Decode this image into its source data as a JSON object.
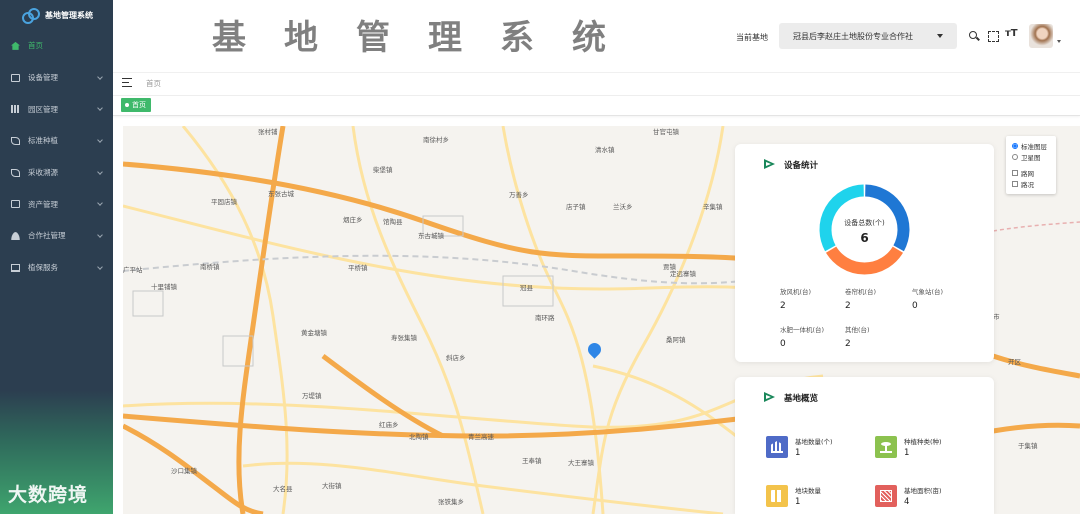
{
  "sidebar": {
    "brand": "基地管理系统",
    "watermark": "大数跨境",
    "items": [
      {
        "label": "首页",
        "active": true
      },
      {
        "label": "设备管理"
      },
      {
        "label": "园区管理"
      },
      {
        "label": "标准种植"
      },
      {
        "label": "采收溯源"
      },
      {
        "label": "资产管理"
      },
      {
        "label": "合作社管理"
      },
      {
        "label": "植保服务"
      }
    ]
  },
  "header": {
    "title": "基地管理系统",
    "base_label": "当前基地",
    "base_value": "冠县后李赵庄土地股份专业合作社",
    "font_size_icon_text": "тT"
  },
  "breadcrumb": "首页",
  "tag": "首页",
  "map": {
    "layer_control": {
      "standard": "标准图层",
      "satellite": "卫星图",
      "roadnet": "路网",
      "traffic": "路况"
    },
    "labels": [
      "张村铺",
      "南徐村乡",
      "清水镇",
      "甘官屯镇",
      "柴堡镇",
      "东张古城",
      "平固店镇",
      "万善乡",
      "店子镇",
      "兰沃乡",
      "辛集镇",
      "烟庄乡",
      "馆陶县",
      "东古城镇",
      "平桥镇",
      "南桥镇",
      "十里铺镇",
      "冠县",
      "南环路",
      "贾镇",
      "定远寨镇",
      "黄金塘镇",
      "寿张集镇",
      "斜店乡",
      "桑阿镇",
      "万堤镇",
      "红庙乡",
      "北陶镇",
      "青兰高速",
      "王奉镇",
      "大王寨镇",
      "沙口集镇",
      "大名县",
      "大街镇",
      "张铁集乡",
      "于集镇",
      "广平站",
      "开区",
      "市"
    ]
  },
  "device_stats": {
    "title": "设备统计",
    "total_label": "设备总数(个)",
    "total": "6",
    "colors": [
      "#1f77d4",
      "#ff7f40",
      "#1fd3ec"
    ],
    "items": [
      {
        "label": "放风机(台)",
        "value": "2"
      },
      {
        "label": "卷帘机(台)",
        "value": "2"
      },
      {
        "label": "气象站(台)",
        "value": "0"
      },
      {
        "label": "水肥一体机(台)",
        "value": "0"
      },
      {
        "label": "其他(台)",
        "value": "2"
      }
    ]
  },
  "base_overview": {
    "title": "基地概览",
    "items": [
      {
        "label": "基地数量(个)",
        "value": "1",
        "icon": "bank-icon"
      },
      {
        "label": "种植种类(种)",
        "value": "1",
        "icon": "sprout-icon"
      },
      {
        "label": "地块数量",
        "value": "1",
        "icon": "plots-icon"
      },
      {
        "label": "基地面积(亩)",
        "value": "4",
        "icon": "area-icon"
      }
    ]
  }
}
